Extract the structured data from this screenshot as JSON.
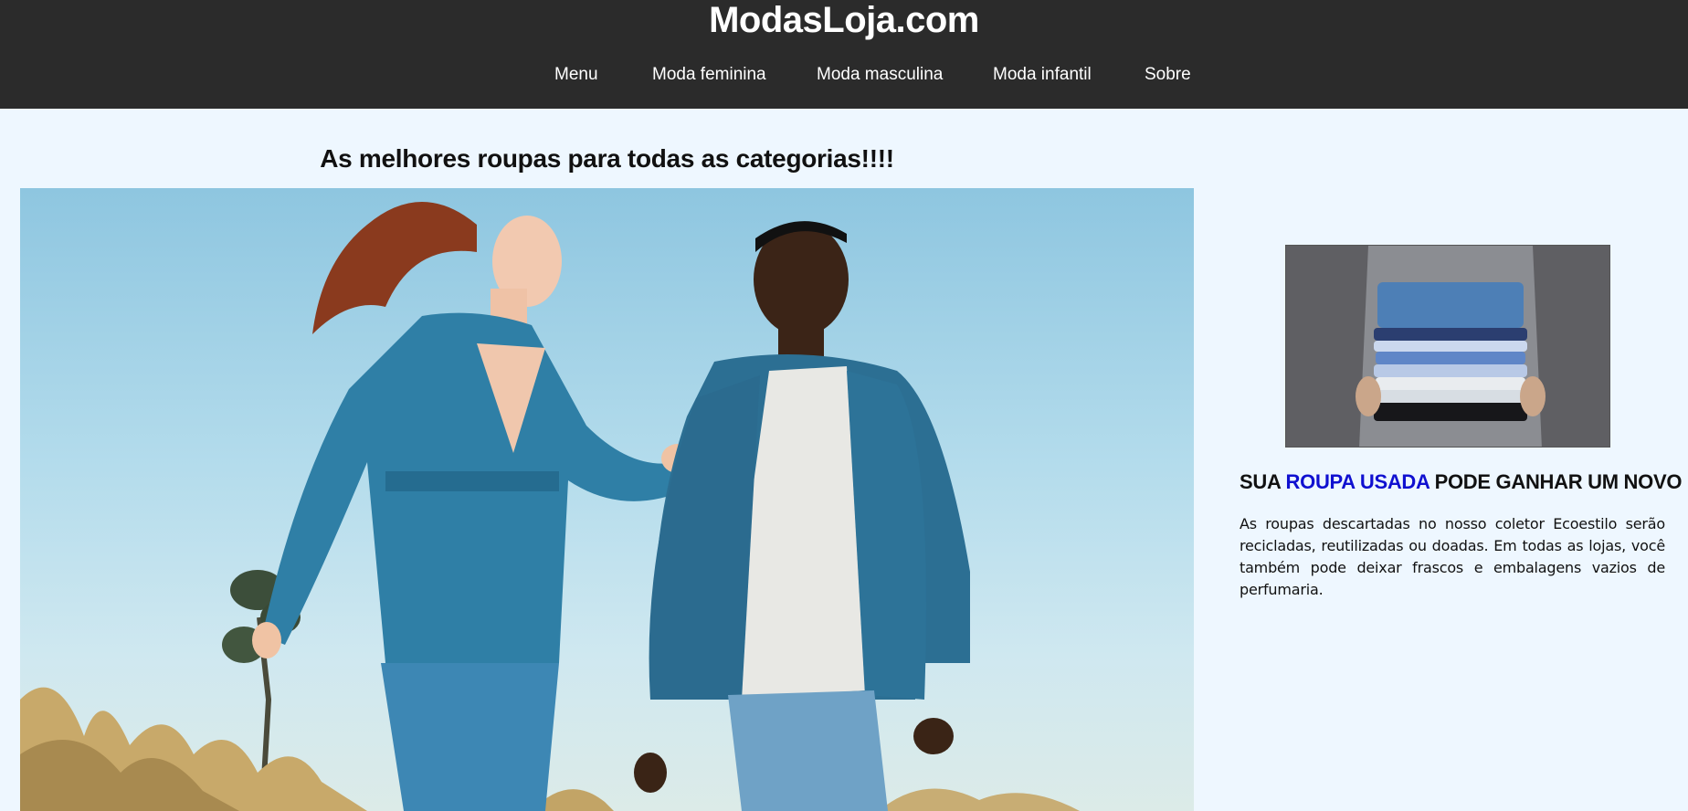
{
  "header": {
    "title": "ModasLoja.com",
    "nav": [
      {
        "label": "Menu"
      },
      {
        "label": "Moda feminina"
      },
      {
        "label": "Moda masculina"
      },
      {
        "label": "Moda infantil"
      },
      {
        "label": "Sobre"
      }
    ]
  },
  "main": {
    "heading": "As melhores roupas para todas as categorias!!!!"
  },
  "sidebar": {
    "heading_part1": "SUA ",
    "heading_accent": "ROUPA USADA",
    "heading_part2": " PODE GANHAR UM NOVO USO",
    "text": "As roupas descartadas no nosso coletor Ecoestilo serão recicladas, reutilizadas ou doadas. Em todas as lojas, você também pode deixar frascos e embalagens vazios de perfumaria."
  },
  "colors": {
    "header_bg": "#2b2b2b",
    "page_bg": "#eef7ff",
    "accent": "#1010d0"
  }
}
